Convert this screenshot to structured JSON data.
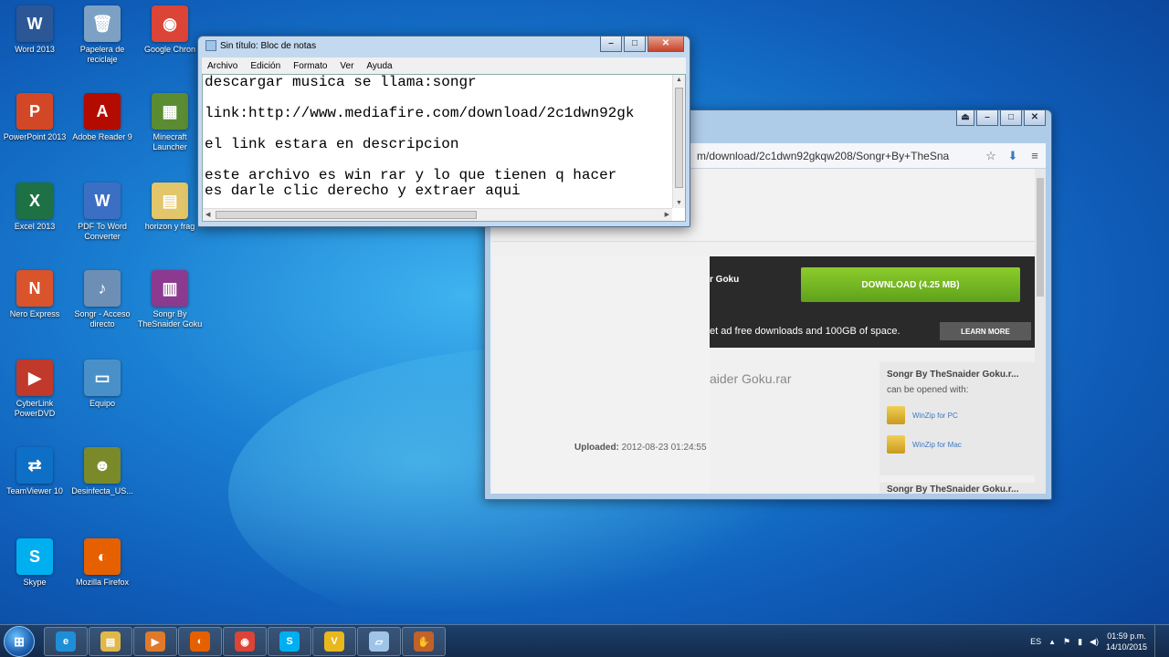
{
  "desktop_icons": [
    {
      "label": "Word 2013",
      "glyph": "W",
      "color": "#2b5797",
      "icon": "word-icon"
    },
    {
      "label": "Papelera de reciclaje",
      "glyph": "🗑",
      "color": "#7da1c4",
      "icon": "recycle-bin-icon"
    },
    {
      "label": "Google Chron",
      "glyph": "◉",
      "color": "#db4437",
      "icon": "chrome-icon"
    },
    {
      "label": "PowerPoint 2013",
      "glyph": "P",
      "color": "#d24726",
      "icon": "powerpoint-icon"
    },
    {
      "label": "Adobe Reader 9",
      "glyph": "A",
      "color": "#b30b00",
      "icon": "adobe-reader-icon"
    },
    {
      "label": "Minecraft Launcher",
      "glyph": "▦",
      "color": "#5b8c32",
      "icon": "minecraft-icon"
    },
    {
      "label": "Excel 2013",
      "glyph": "X",
      "color": "#1e7145",
      "icon": "excel-icon"
    },
    {
      "label": "PDF To Word Converter",
      "glyph": "W",
      "color": "#3b6fc4",
      "icon": "pdf-to-word-icon"
    },
    {
      "label": "horizon y frag",
      "glyph": "▤",
      "color": "#e3c56a",
      "icon": "folder-icon"
    },
    {
      "label": "Nero Express",
      "glyph": "N",
      "color": "#d9532b",
      "icon": "nero-icon"
    },
    {
      "label": "Songr - Acceso directo",
      "glyph": "♪",
      "color": "#6d8fb5",
      "icon": "songr-icon"
    },
    {
      "label": "Songr By TheSnaider Goku",
      "glyph": "▥",
      "color": "#8b3a8f",
      "icon": "winrar-icon"
    },
    {
      "label": "CyberLink PowerDVD",
      "glyph": "▶",
      "color": "#c0392b",
      "icon": "powerdvd-icon"
    },
    {
      "label": "Equipo",
      "glyph": "▭",
      "color": "#4a90c8",
      "icon": "computer-icon"
    },
    {
      "label": "TeamViewer 10",
      "glyph": "⇄",
      "color": "#0e6fc7",
      "icon": "teamviewer-icon"
    },
    {
      "label": "Desinfecta_US...",
      "glyph": "☻",
      "color": "#7a8a2a",
      "icon": "desinfecta-icon"
    },
    {
      "label": "Skype",
      "glyph": "S",
      "color": "#00aff0",
      "icon": "skype-icon"
    },
    {
      "label": "Mozilla Firefox",
      "glyph": "◐",
      "color": "#e66000",
      "icon": "firefox-icon"
    }
  ],
  "notepad": {
    "title": "Sin título: Bloc de notas",
    "menu": [
      "Archivo",
      "Edición",
      "Formato",
      "Ver",
      "Ayuda"
    ],
    "content": "descargar musica se llama:songr\n\nlink:http://www.mediafire.com/download/2c1dwn92gk\n\nel link estara en descripcion\n\neste archivo es win rar y lo que tienen q hacer\nes darle clic derecho y extraer aqui"
  },
  "browser": {
    "url": "m/download/2c1dwn92gkqw208/Songr+By+TheSna",
    "banner_name": "r Goku",
    "download_label": "DOWNLOAD (4.25 MB)",
    "ad_text": "et ad free downloads and 100GB of space.",
    "learn_more": "LEARN MORE",
    "filename": "aider Goku.rar",
    "uploaded_label": "Uploaded:",
    "uploaded_value": "2012-08-23 01:24:55",
    "side_title": "Songr By TheSnaider Goku.r...",
    "side_sub": "can be opened with:",
    "winzip_pc": "WinZip for PC",
    "winzip_mac": "WinZip for Mac",
    "side_title_2": "Songr By TheSnaider Goku.r..."
  },
  "taskbar": {
    "items": [
      {
        "icon": "internet-explorer-icon",
        "glyph": "e",
        "color": "#1e8fd6"
      },
      {
        "icon": "file-explorer-icon",
        "glyph": "▤",
        "color": "#e0b84a"
      },
      {
        "icon": "media-player-icon",
        "glyph": "▶",
        "color": "#e07a2a"
      },
      {
        "icon": "firefox-icon",
        "glyph": "◐",
        "color": "#e66000"
      },
      {
        "icon": "chrome-icon",
        "glyph": "◉",
        "color": "#db4437"
      },
      {
        "icon": "skype-icon",
        "glyph": "S",
        "color": "#00aff0"
      },
      {
        "icon": "v-app-icon",
        "glyph": "V",
        "color": "#e8b81c"
      },
      {
        "icon": "notepad-icon",
        "glyph": "▱",
        "color": "#9fc4e8"
      },
      {
        "icon": "baseball-glove-icon",
        "glyph": "✋",
        "color": "#c0622a"
      }
    ],
    "language": "ES",
    "time": "01:59 p.m.",
    "date": "14/10/2015"
  }
}
